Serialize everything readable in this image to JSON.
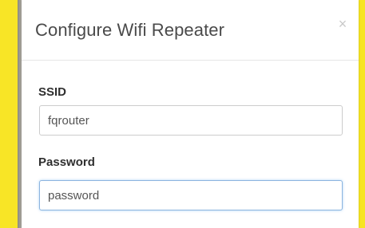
{
  "dialog": {
    "title": "Configure Wifi Repeater",
    "close_label": "×"
  },
  "form": {
    "ssid": {
      "label": "SSID",
      "value": "fqrouter"
    },
    "password": {
      "label": "Password",
      "value": "password"
    }
  },
  "colors": {
    "background_accent": "#fbe928",
    "dialog_background": "#ffffff",
    "focus_border": "#8cb4df"
  }
}
